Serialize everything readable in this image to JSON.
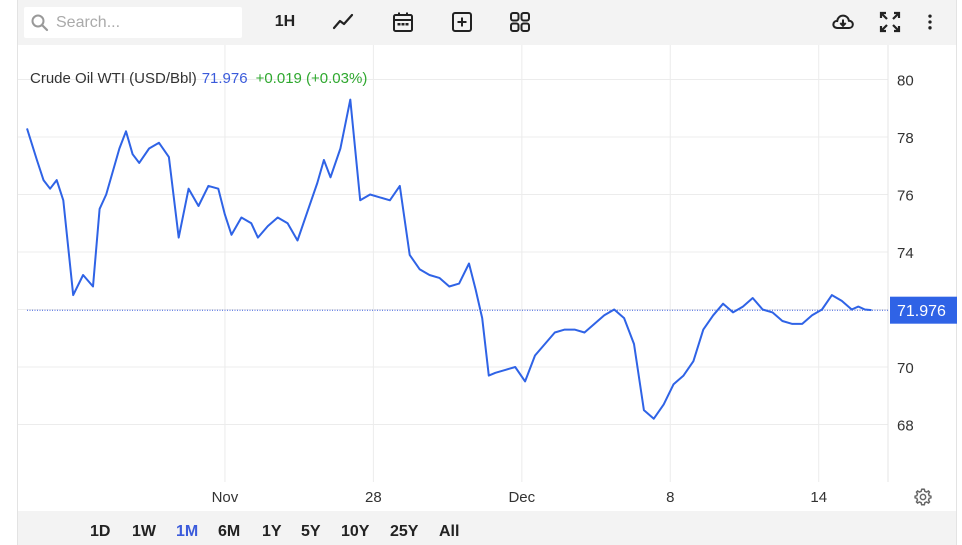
{
  "toolbar": {
    "search_placeholder": "Search...",
    "interval_label": "1H",
    "icons": [
      "line-chart-icon",
      "calendar-icon",
      "add-square-icon",
      "grid-icon",
      "cloud-download-icon",
      "fullscreen-icon",
      "more-vertical-icon"
    ]
  },
  "header": {
    "symbol": "Crude Oil WTI (USD/Bbl)",
    "price": "71.976",
    "change": "+0.019 (+0.03%)"
  },
  "colors": {
    "line": "#2f63e6",
    "price_label_bg": "#2f63e6",
    "change_positive": "#2fa82f",
    "grid": "#ececec"
  },
  "periods": [
    {
      "label": "1D",
      "active": false
    },
    {
      "label": "1W",
      "active": false
    },
    {
      "label": "1M",
      "active": true
    },
    {
      "label": "6M",
      "active": false
    },
    {
      "label": "1Y",
      "active": false
    },
    {
      "label": "5Y",
      "active": false
    },
    {
      "label": "10Y",
      "active": false
    },
    {
      "label": "25Y",
      "active": false
    },
    {
      "label": "All",
      "active": false
    }
  ],
  "chart_data": {
    "type": "line",
    "x_tick_labels": [
      {
        "label": "Nov",
        "x": 6.0
      },
      {
        "label": "28",
        "x": 10.5
      },
      {
        "label": "Dec",
        "x": 15.0
      },
      {
        "label": "8",
        "x": 19.5
      },
      {
        "label": "14",
        "x": 24.0
      }
    ],
    "y_ticks": [
      68,
      70,
      72,
      74,
      76,
      78,
      80
    ],
    "y_tick_labels": [
      "68",
      "70",
      "74",
      "76",
      "78",
      "80"
    ],
    "ylim": [
      66.0,
      81.2
    ],
    "xlim": [
      0,
      26.1
    ],
    "current_value": 71.976,
    "current_value_label": "71.976",
    "grid": true,
    "series": [
      {
        "x": [
          0.0,
          0.3,
          0.5,
          0.7,
          0.9,
          1.1,
          1.4,
          1.7,
          2.0,
          2.2,
          2.4,
          2.6,
          2.8,
          3.0,
          3.2,
          3.4,
          3.7,
          4.0,
          4.3,
          4.6,
          4.9,
          5.0,
          5.2,
          5.5,
          5.8,
          6.0,
          6.2,
          6.5,
          6.8,
          7.0,
          7.3,
          7.6,
          7.9,
          8.2,
          8.5,
          8.8,
          9.0,
          9.2,
          9.5,
          9.8,
          10.1,
          10.4,
          10.7,
          11.0,
          11.3,
          11.6,
          11.9,
          12.2,
          12.5,
          12.8,
          13.1,
          13.4,
          13.6,
          13.8,
          14.0,
          14.2,
          14.5,
          14.8,
          15.1,
          15.4,
          15.7,
          16.0,
          16.3,
          16.6,
          16.9,
          17.2,
          17.5,
          17.8,
          18.1,
          18.4,
          18.7,
          19.0,
          19.3,
          19.6,
          19.9,
          20.2,
          20.5,
          20.8,
          21.1,
          21.4,
          21.7,
          22.0,
          22.3,
          22.6,
          22.9,
          23.2,
          23.5,
          23.8,
          24.1,
          24.4,
          24.7,
          25.0,
          25.2,
          25.4,
          25.6
        ],
        "y": [
          78.3,
          77.2,
          76.5,
          76.2,
          76.5,
          75.8,
          72.5,
          73.2,
          72.8,
          75.5,
          76.0,
          76.8,
          77.6,
          78.2,
          77.4,
          77.1,
          77.6,
          77.8,
          77.3,
          74.5,
          76.2,
          76.0,
          75.6,
          76.3,
          76.2,
          75.3,
          74.6,
          75.2,
          75.0,
          74.5,
          74.9,
          75.2,
          75.0,
          74.4,
          75.4,
          76.4,
          77.2,
          76.6,
          77.6,
          79.3,
          75.8,
          76.0,
          75.9,
          75.8,
          76.3,
          73.9,
          73.4,
          73.2,
          73.1,
          72.8,
          72.9,
          73.6,
          72.7,
          71.7,
          69.7,
          69.8,
          69.9,
          70.0,
          69.5,
          70.4,
          70.8,
          71.2,
          71.3,
          71.3,
          71.2,
          71.5,
          71.8,
          72.0,
          71.7,
          70.8,
          68.5,
          68.2,
          68.7,
          69.4,
          69.7,
          70.2,
          71.3,
          71.8,
          72.2,
          71.9,
          72.1,
          72.4,
          72.0,
          71.9,
          71.6,
          71.5,
          71.5,
          71.8,
          72.0,
          72.5,
          72.3,
          72.0,
          72.1,
          72.0,
          71.98
        ]
      }
    ]
  }
}
